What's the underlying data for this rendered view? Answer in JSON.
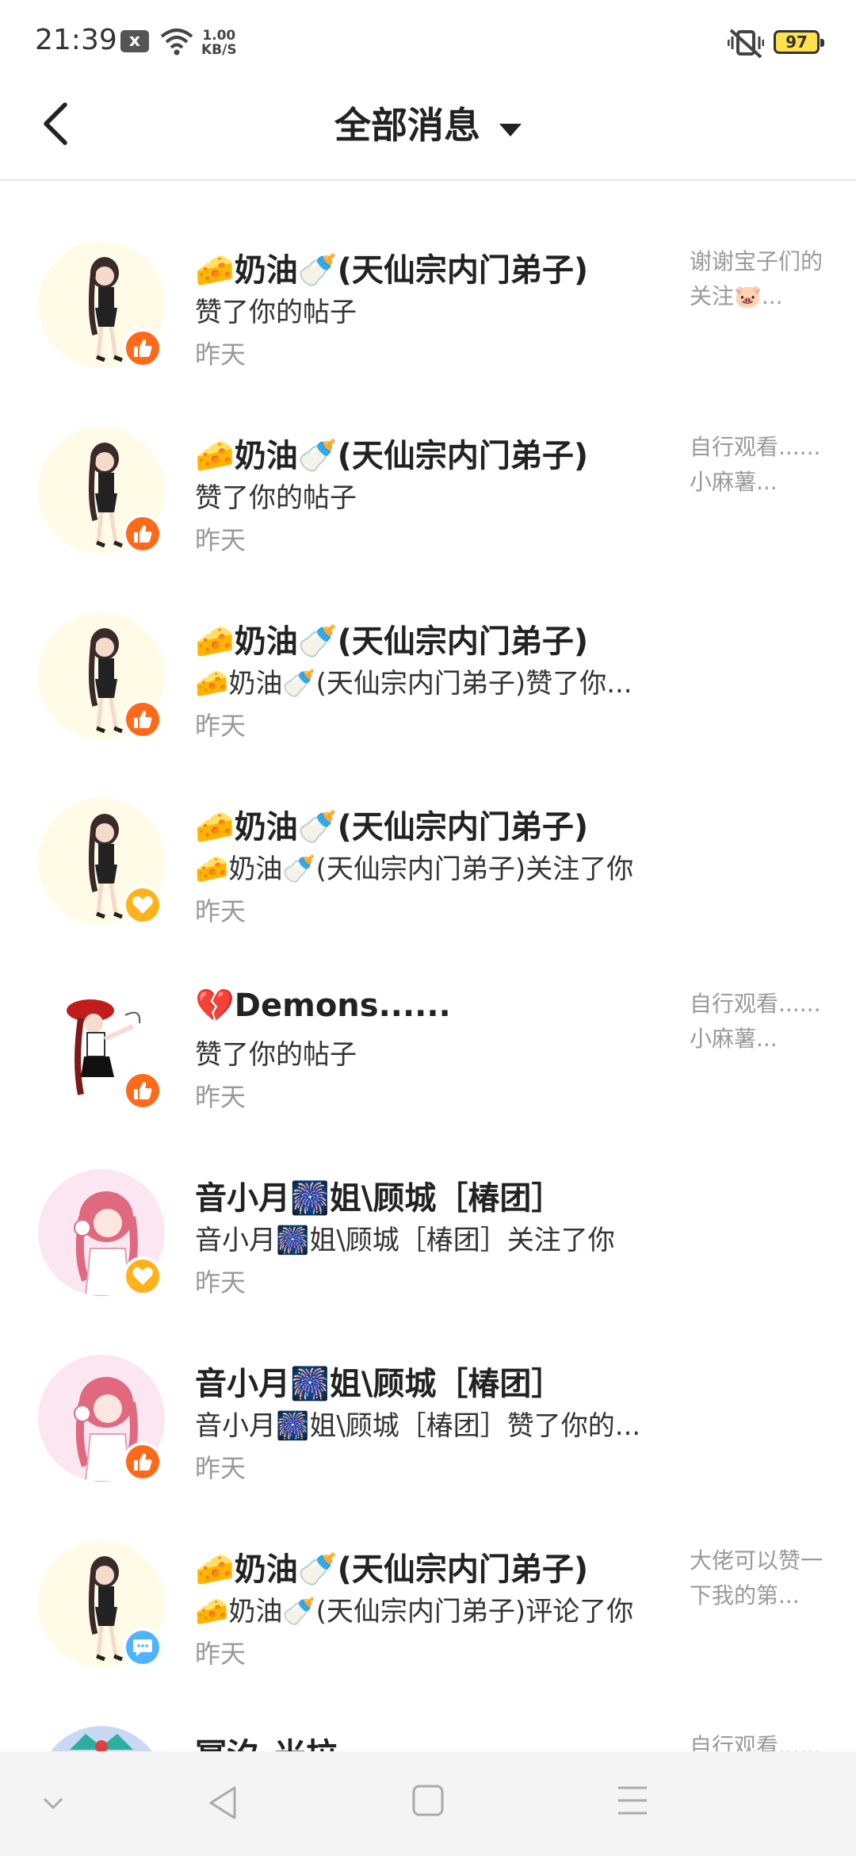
{
  "status_bar": {
    "time": "21:39",
    "notif_icon": "x",
    "speed_value": "1.00",
    "speed_unit": "KB/S",
    "battery": "97"
  },
  "header": {
    "title": "全部消息"
  },
  "colors": {
    "like": "#ff6a1a",
    "follow": "#ffb21a",
    "comment": "#4fb3ff",
    "battery": "#ffe14d"
  },
  "messages": [
    {
      "name": "🧀奶油🍼(天仙宗内门弟子)",
      "action": "赞了你的帖子",
      "time": "昨天",
      "preview": "谢谢宝子们的关注🐷...",
      "badge": "like-icon",
      "avatar": "maid-girl-avatar"
    },
    {
      "name": "🧀奶油🍼(天仙宗内门弟子)",
      "action": "赞了你的帖子",
      "time": "昨天",
      "preview": "自行观看......小麻薯...",
      "badge": "like-icon",
      "avatar": "maid-girl-avatar"
    },
    {
      "name": "🧀奶油🍼(天仙宗内门弟子)",
      "action": "🧀奶油🍼(天仙宗内门弟子)赞了你...",
      "time": "昨天",
      "preview": "",
      "badge": "like-icon",
      "avatar": "maid-girl-avatar"
    },
    {
      "name": "🧀奶油🍼(天仙宗内门弟子)",
      "action": "🧀奶油🍼(天仙宗内门弟子)关注了你",
      "time": "昨天",
      "preview": "",
      "badge": "heart-icon",
      "avatar": "maid-girl-avatar"
    },
    {
      "name": "💔Demons......",
      "action": "赞了你的帖子",
      "time": "昨天",
      "preview": "自行观看......小麻薯...",
      "badge": "like-icon",
      "avatar": "red-hat-girl-avatar"
    },
    {
      "name": "音小月🎆姐\\顾城［椿团］",
      "action": "音小月🎆姐\\顾城［椿团］关注了你",
      "time": "昨天",
      "preview": "",
      "badge": "heart-icon",
      "avatar": "pink-hair-girl-avatar"
    },
    {
      "name": "音小月🎆姐\\顾城［椿团］",
      "action": "音小月🎆姐\\顾城［椿团］赞了你的...",
      "time": "昨天",
      "preview": "",
      "badge": "like-icon",
      "avatar": "pink-hair-girl-avatar"
    },
    {
      "name": "🧀奶油🍼(天仙宗内门弟子)",
      "action": "🧀奶油🍼(天仙宗内门弟子)评论了你",
      "time": "昨天",
      "preview": "大佬可以赞一下我的第...",
      "badge": "comment-icon",
      "avatar": "maid-girl-avatar"
    },
    {
      "name": "冥汐_米拉",
      "action": "",
      "time": "",
      "preview": "自行观看......",
      "badge": "",
      "avatar": "blue-avatar"
    }
  ]
}
